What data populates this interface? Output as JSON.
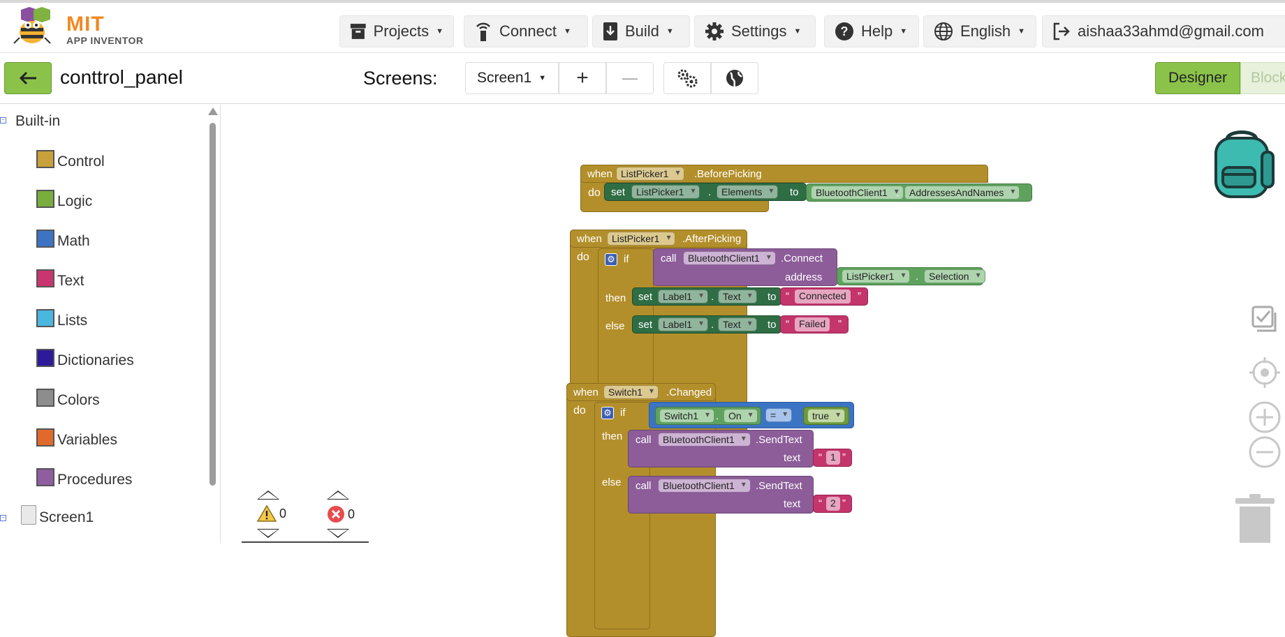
{
  "app": {
    "brand_top": "MIT",
    "brand_bottom": "APP INVENTOR"
  },
  "menu": {
    "projects": "Projects",
    "connect": "Connect",
    "build": "Build",
    "settings": "Settings",
    "help": "Help",
    "language": "English",
    "account": "aishaa33ahmd@gmail.com"
  },
  "toolbar": {
    "project_name": "conttrol_panel",
    "screens_label": "Screens:",
    "screen_selected": "Screen1",
    "add_screen": "+",
    "remove_screen": "—",
    "designer": "Designer",
    "blocks": "Block"
  },
  "sidebar": {
    "root": "Built-in",
    "categories": [
      {
        "label": "Control",
        "color": "#c9a13b"
      },
      {
        "label": "Logic",
        "color": "#79ad3d"
      },
      {
        "label": "Math",
        "color": "#3d73c2"
      },
      {
        "label": "Text",
        "color": "#c9356e"
      },
      {
        "label": "Lists",
        "color": "#4bb6e0"
      },
      {
        "label": "Dictionaries",
        "color": "#2c1a9a"
      },
      {
        "label": "Colors",
        "color": "#8d8d8d"
      },
      {
        "label": "Variables",
        "color": "#e06a2c"
      },
      {
        "label": "Procedures",
        "color": "#8f5e9f"
      }
    ],
    "screen_node": "Screen1"
  },
  "blocks": {
    "b1": {
      "when": "when",
      "component": "ListPicker1",
      "event": ".BeforePicking",
      "do": "do",
      "set": "set",
      "set_component": "ListPicker1",
      "dot": ".",
      "property": "Elements",
      "to": "to",
      "value_component": "BluetoothClient1",
      "value_property": "AddressesAndNames"
    },
    "b2": {
      "when": "when",
      "component": "ListPicker1",
      "event": ".AfterPicking",
      "do": "do",
      "if": "if",
      "call": "call",
      "call_component": "BluetoothClient1",
      "method": ".Connect",
      "address": "address",
      "addr_component": "ListPicker1",
      "addr_property": "Selection",
      "then": "then",
      "else": "else",
      "set": "set",
      "label": "Label1",
      "text_prop": "Text",
      "to": "to",
      "connected": "Connected",
      "failed": "Failed"
    },
    "b3": {
      "when": "when",
      "component": "Switch1",
      "event": ".Changed",
      "do": "do",
      "if": "if",
      "cmp_component": "Switch1",
      "cmp_property": "On",
      "op": "=",
      "bool": "true",
      "then": "then",
      "else": "else",
      "call": "call",
      "call_component": "BluetoothClient1",
      "method": ".SendText",
      "text": "text",
      "val1": "1",
      "val2": "2"
    }
  },
  "status": {
    "warnings": "0",
    "errors": "0"
  }
}
